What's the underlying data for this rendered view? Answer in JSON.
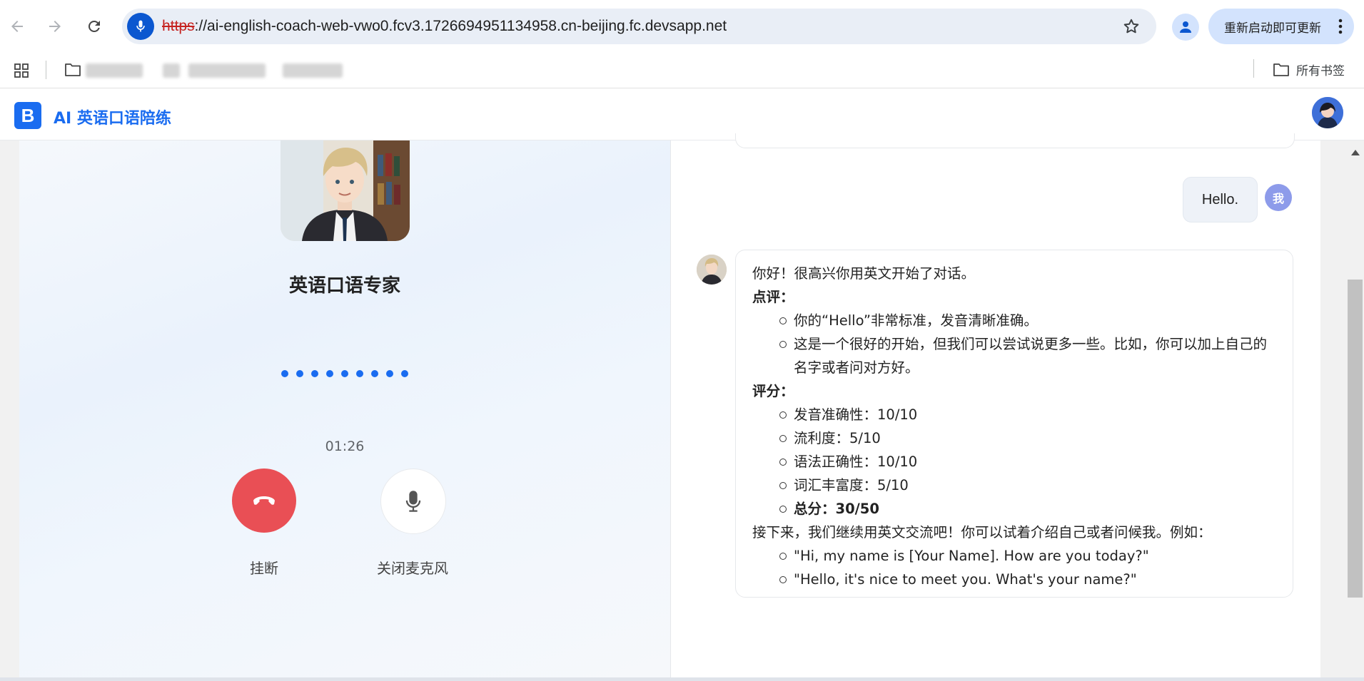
{
  "browser": {
    "url_scheme": "https",
    "url_rest": "://ai-english-coach-web-vwo0.fcv3.1726694951134958.cn-beijing.fc.devsapp.net",
    "update_label": "重新启动即可更新",
    "all_bookmarks_label": "所有书签"
  },
  "app": {
    "logo_letter": "B",
    "title": "AI 英语口语陪练"
  },
  "call": {
    "expert_name": "英语口语专家",
    "timer": "01:26",
    "hangup_label": "挂断",
    "mic_label": "关闭麦克风"
  },
  "chat": {
    "user_message": "Hello.",
    "user_avatar_text": "我",
    "reply": {
      "intro": "你好！很高兴你用英文开始了对话。",
      "comment_heading": "点评：",
      "comments": [
        "你的“Hello”非常标准，发音清晰准确。",
        "这是一个很好的开始，但我们可以尝试说更多一些。比如，你可以加上自己的名字或者问对方好。"
      ],
      "score_heading": "评分：",
      "scores": [
        "发音准确性：10/10",
        "流利度：5/10",
        "语法正确性：10/10",
        "词汇丰富度：5/10"
      ],
      "total": "总分：30/50",
      "next": "接下来，我们继续用英文交流吧！你可以试着介绍自己或者问候我。例如：",
      "examples": [
        "\"Hi, my name is [Your Name]. How are you today?\"",
        "\"Hello, it's nice to meet you. What's your name?\""
      ]
    }
  },
  "icons": {
    "back": "arrow-left-icon",
    "forward": "arrow-right-icon",
    "reload": "reload-icon",
    "mic": "mic-icon",
    "star": "star-icon",
    "profile": "profile-icon",
    "menu": "more-vert-icon",
    "apps": "apps-grid-icon",
    "folder": "folder-icon",
    "hangup": "phone-hangup-icon"
  },
  "colors": {
    "accent": "#1a6cf0",
    "hangup": "#e94f55",
    "user_avatar": "#8d9bea"
  }
}
